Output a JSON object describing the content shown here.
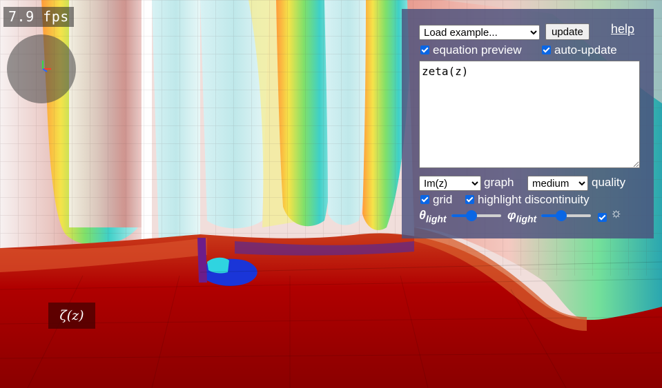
{
  "viewport": {
    "fps_text": "7.9 fps",
    "equation_label": "ζ(z)"
  },
  "controls": {
    "examples_select": {
      "value": "Load example..."
    },
    "update_button": "update",
    "help_link": "help",
    "equation_preview": {
      "label": "equation preview",
      "checked": true
    },
    "auto_update": {
      "label": "auto-update",
      "checked": true
    },
    "equation_text": "zeta(z)",
    "graph_select": {
      "value": "Im(z)"
    },
    "graph_label": "graph",
    "quality_select": {
      "value": "medium"
    },
    "quality_label": "quality",
    "grid": {
      "label": "grid",
      "checked": true
    },
    "highlight_discontinuity": {
      "label": "highlight discontinuity",
      "checked": true
    },
    "theta_light": {
      "symbol": "θ",
      "subscript": "light",
      "value": 0.4
    },
    "phi_light": {
      "symbol": "φ",
      "subscript": "light",
      "value": 0.4
    },
    "light_toggle": {
      "icon": "sun-icon",
      "glyph": "☼",
      "checked": true
    }
  }
}
